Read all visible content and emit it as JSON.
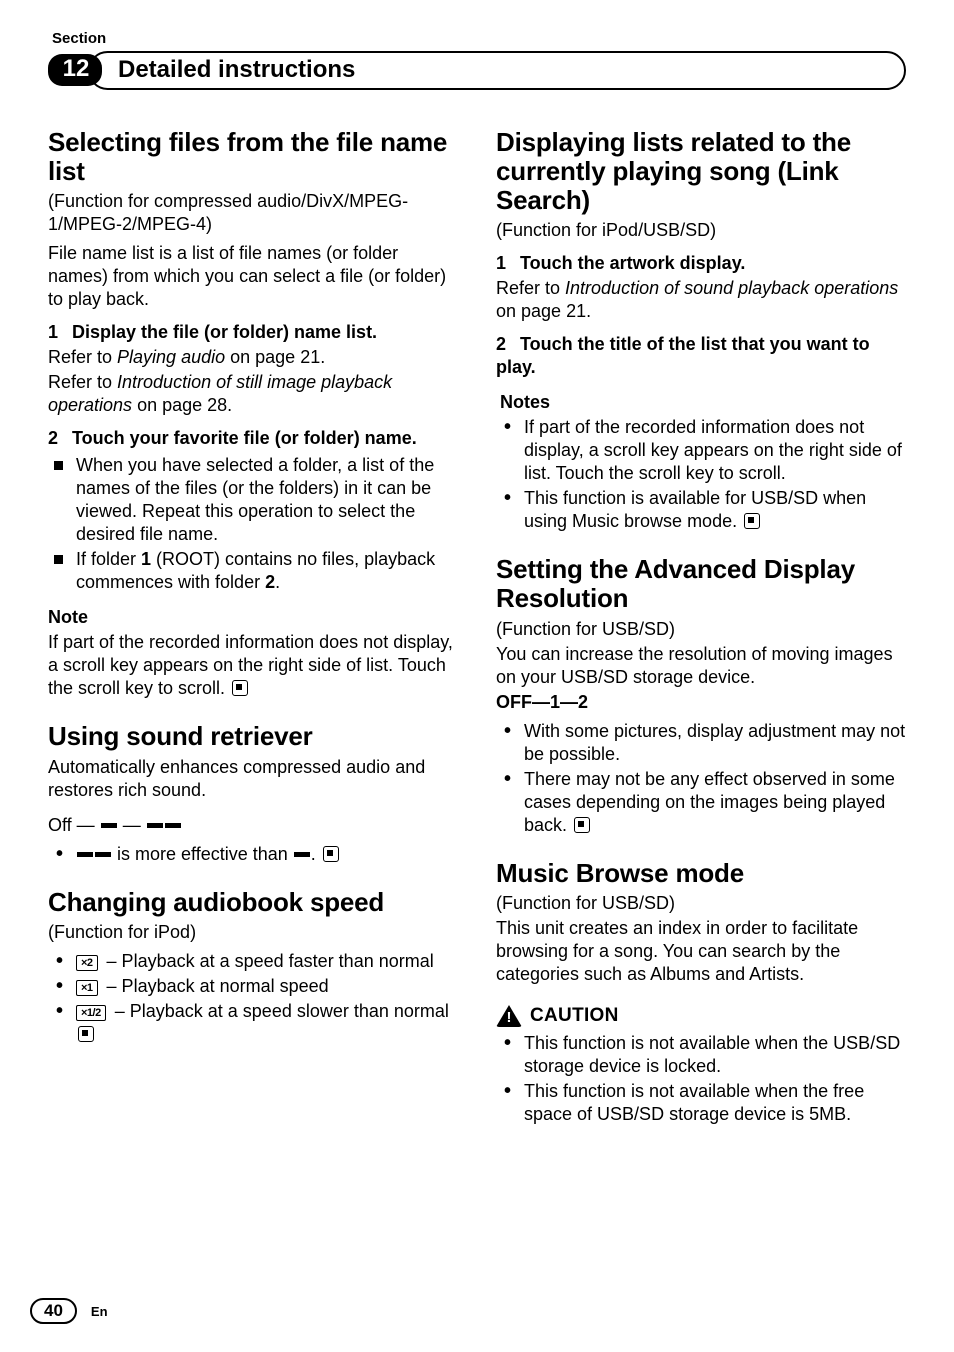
{
  "meta": {
    "section_label": "Section",
    "chapter_number": "12",
    "chapter_title": "Detailed instructions",
    "page_number": "40",
    "language": "En"
  },
  "left": {
    "selecting_files": {
      "heading": "Selecting files from the file name list",
      "intro_paren": "(Function for compressed audio/DivX/MPEG-1/MPEG-2/MPEG-4)",
      "intro_body": "File name list is a list of file names (or folder names) from which you can select a file (or folder) to play back.",
      "step1_head_num": "1",
      "step1_head_text": "Display the file (or folder) name list.",
      "step1_ref1_prefix": "Refer to ",
      "step1_ref1_italic": "Playing audio",
      "step1_ref1_suffix": " on page 21.",
      "step1_ref2_prefix": "Refer to ",
      "step1_ref2_italic": "Introduction of still image playback operations",
      "step1_ref2_suffix": " on page 28.",
      "step2_head_num": "2",
      "step2_head_text": "Touch your favorite file (or folder) name.",
      "step2_b1": "When you have selected a folder, a list of the names of the files (or the folders) in it can be viewed. Repeat this operation to select the desired file name.",
      "step2_b2_a": "If folder ",
      "step2_b2_b": "1",
      "step2_b2_c": " (ROOT) contains no files, playback commences with folder ",
      "step2_b2_d": "2",
      "step2_b2_e": ".",
      "note_head": "Note",
      "note_body": "If part of the recorded information does not display, a scroll key appears on the right side of list. Touch the scroll key to scroll."
    },
    "sound_retriever": {
      "heading": "Using sound retriever",
      "body": "Automatically enhances compressed audio and restores rich sound.",
      "levels_prefix": "Off — ",
      "levels_sep": " — ",
      "bullet_a": " is more effective than ",
      "bullet_b": "."
    },
    "audiobook": {
      "heading": "Changing audiobook speed",
      "func": "(Function for iPod)",
      "box2": "×2",
      "item2": " – Playback at a speed faster than normal",
      "box1": "×1",
      "item1": " – Playback at normal speed",
      "boxhalf": "×1/2",
      "itemhalf": " – Playback at a speed slower than normal"
    }
  },
  "right": {
    "link_search": {
      "heading": "Displaying lists related to the currently playing song (Link Search)",
      "func": "(Function for iPod/USB/SD)",
      "step1_num": "1",
      "step1_text": "Touch the artwork display.",
      "step1_ref_prefix": "Refer to ",
      "step1_ref_italic": "Introduction of sound playback operations",
      "step1_ref_suffix": " on page 21.",
      "step2_num": "2",
      "step2_text": "Touch the title of the list that you want to play.",
      "notes_head": "Notes",
      "note1": "If part of the recorded information does not display, a scroll key appears on the right side of list. Touch the scroll key to scroll.",
      "note2": "This function is available for USB/SD when using Music browse mode."
    },
    "adv_res": {
      "heading": "Setting the Advanced Display Resolution",
      "func": "(Function for USB/SD)",
      "body": "You can increase the resolution of moving images on your USB/SD storage device.",
      "levels": "OFF—1—2",
      "b1": "With some pictures, display adjustment may not be possible.",
      "b2": "There may not be any effect observed in some cases depending on the images being played back."
    },
    "music_browse": {
      "heading": "Music Browse mode",
      "func": "(Function for USB/SD)",
      "body": "This unit creates an index in order to facilitate browsing for a song. You can search by the categories such as Albums and Artists.",
      "caution_label": "CAUTION",
      "caution1": "This function is not available when the USB/SD storage device is locked.",
      "caution2": "This function is not available when the free space of USB/SD storage device is 5MB."
    }
  }
}
